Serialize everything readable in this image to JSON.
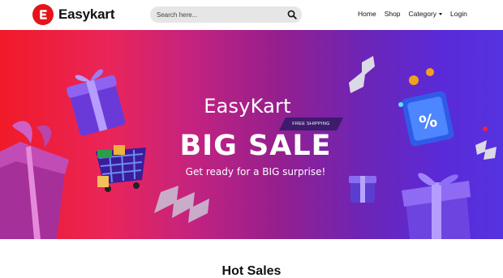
{
  "header": {
    "brand_name": "Easykart",
    "search": {
      "placeholder": "Search here..."
    },
    "nav": [
      "Home",
      "Shop",
      "Category",
      "Login"
    ]
  },
  "hero": {
    "brand": "EasyKart",
    "ribbon": "FREE SHIPPING",
    "headline": "BIG SALE",
    "tagline": "Get ready for a BIG surprise!"
  },
  "sections": {
    "hot_sales_title": "Hot Sales"
  },
  "colors": {
    "brand_red": "#e4141b",
    "hero_start": "#f11a28",
    "hero_end": "#5633e0"
  },
  "icons": {
    "search": "search-icon",
    "logo": "easykart-logo-icon",
    "caret": "chevron-down-icon"
  }
}
